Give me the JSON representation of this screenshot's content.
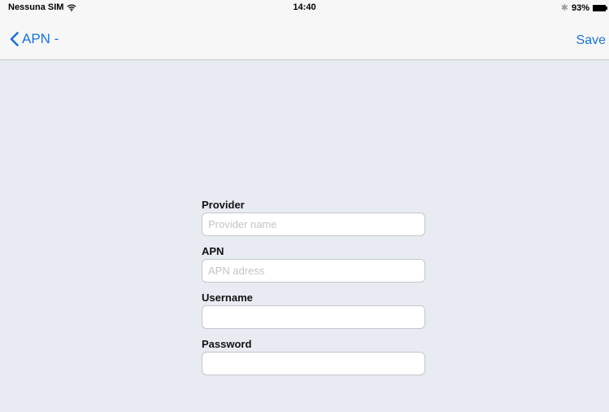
{
  "status_bar": {
    "carrier": "Nessuna SIM",
    "time": "14:40",
    "battery": "93%",
    "icons": [
      "wifi-icon",
      "bluetooth-icon",
      "battery-icon"
    ]
  },
  "nav": {
    "back_label": "APN -",
    "save_label": "Save",
    "accent_color": "#1a73d6"
  },
  "form": {
    "provider": {
      "label": "Provider",
      "value": "",
      "placeholder": "Provider name"
    },
    "apn": {
      "label": "APN",
      "value": "",
      "placeholder": "APN adress"
    },
    "username": {
      "label": "Username",
      "value": "",
      "placeholder": ""
    },
    "password": {
      "label": "Password",
      "value": "",
      "placeholder": ""
    }
  }
}
